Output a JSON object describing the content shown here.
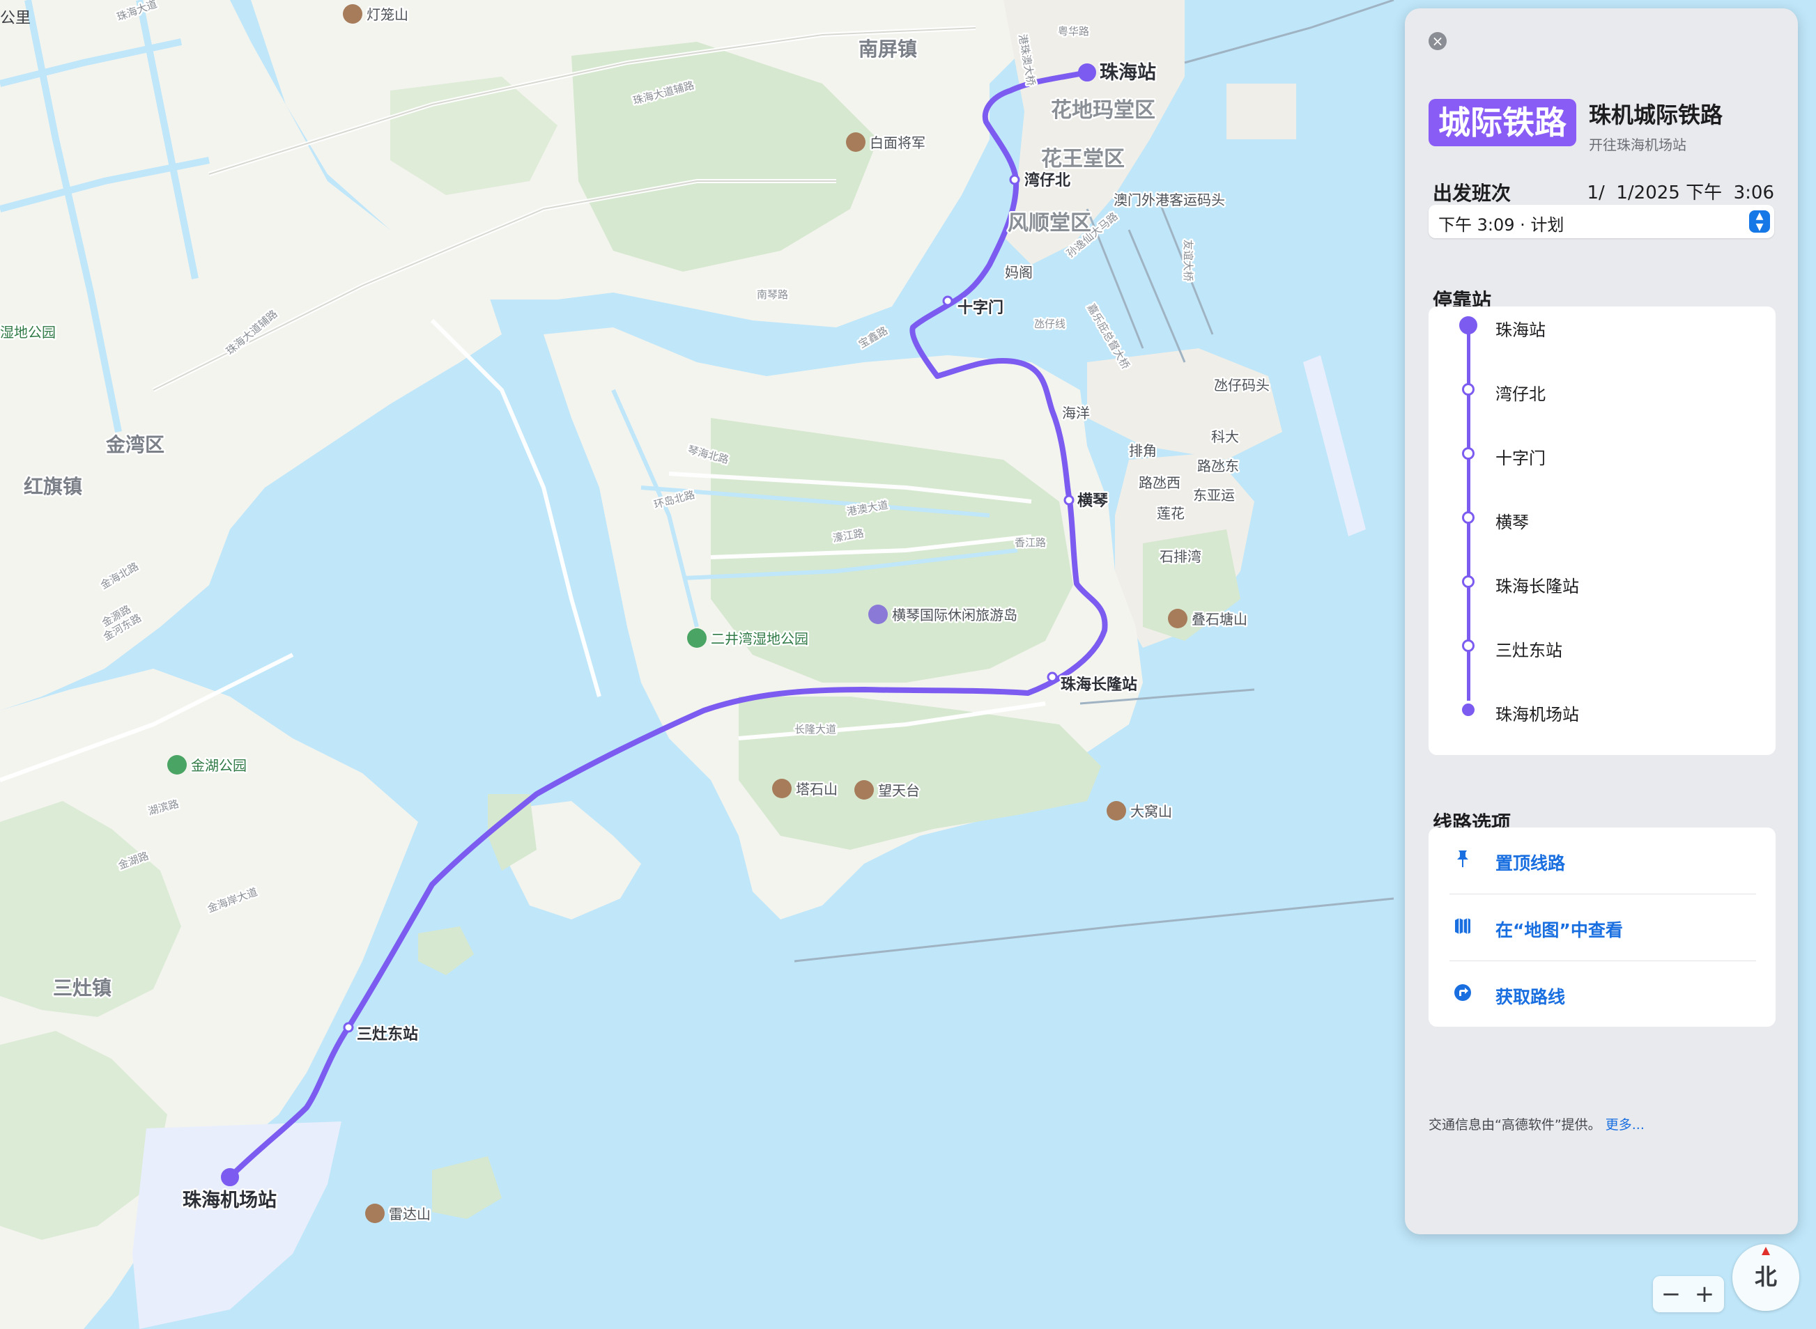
{
  "map": {
    "scale_label": "公里",
    "districts": [
      "花地玛堂区",
      "花王堂区",
      "风顺堂区"
    ],
    "towns": [
      "南屏镇",
      "金湾区",
      "红旗镇",
      "三灶镇"
    ],
    "places": [
      "海洋",
      "排角",
      "路氹西",
      "路氹东",
      "东亚运",
      "科大",
      "莲花",
      "石排湾",
      "氹仔码头",
      "妈阁",
      "澳门外港客运码头"
    ],
    "roads": [
      "珠海大道辅路",
      "珠海大道",
      "珠海大道辅路",
      "南琴路",
      "宝鑫路",
      "琴海北路",
      "环岛北路",
      "港澳大道",
      "濠江路",
      "香江路",
      "长隆大道",
      "金海北路",
      "金源路",
      "湖滨路",
      "金河东路",
      "金湖路",
      "金海岸大道",
      "粤华路",
      "港珠澳大桥",
      "孙逸仙大马路",
      "友谊大桥",
      "嘉乐庇总督大桥",
      "氹仔线"
    ],
    "pois": [
      "灯笼山",
      "白面将军",
      "塔石山",
      "望天台",
      "大窝山",
      "叠石塘山",
      "雷达山",
      "横琴国际休闲旅游岛"
    ],
    "parks": [
      "二井湾湿地公园",
      "金湖公园",
      "湿地公园"
    ],
    "stations": [
      "珠海站",
      "湾仔北",
      "十字门",
      "横琴",
      "珠海长隆站",
      "三灶东站",
      "珠海机场站"
    ],
    "route_color": "#7c5cf0",
    "water_color": "#bfe6f9",
    "land_color": "#f4f4ef",
    "green_color": "#d6e8cf"
  },
  "panel": {
    "close_icon": "close-icon",
    "line_badge": "城际铁路",
    "line_name": "珠机城际铁路",
    "line_direction": "开往珠海机场站",
    "departures_heading": "出发班次",
    "departure_date": "1/  1/2025 下午  3:06",
    "departure_selected": "下午 3:09 · 计划",
    "stops_heading": "停靠站",
    "stops": [
      "珠海站",
      "湾仔北",
      "十字门",
      "横琴",
      "珠海长隆站",
      "三灶东站",
      "珠海机场站"
    ],
    "options_heading": "线路选项",
    "options": [
      {
        "label": "置顶线路",
        "icon": "pin-icon"
      },
      {
        "label": "在“地图”中查看",
        "icon": "map-icon"
      },
      {
        "label": "获取路线",
        "icon": "directions-icon"
      }
    ],
    "footer": "交通信息由“高德软件”提供。",
    "footer_more": "更多..."
  },
  "controls": {
    "zoom_out": "−",
    "zoom_in": "+",
    "compass_label": "北"
  }
}
